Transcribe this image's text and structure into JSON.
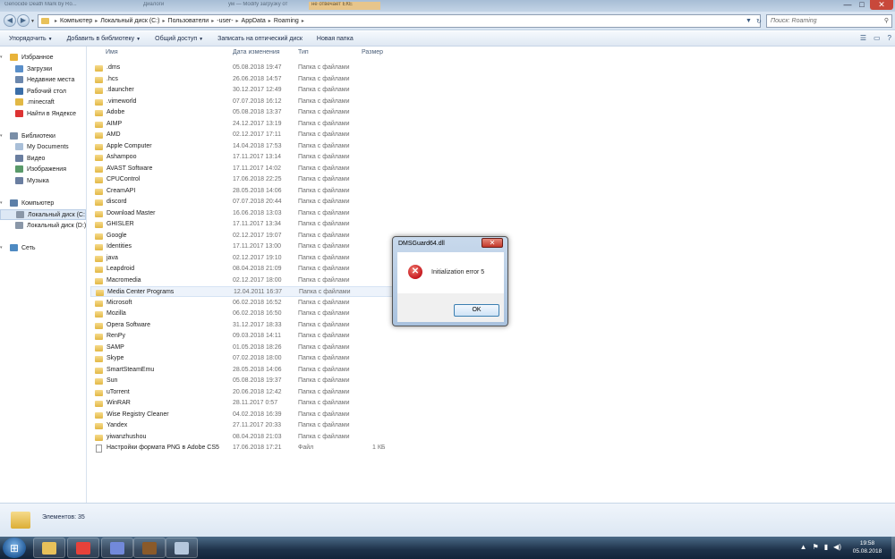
{
  "titlebar": {
    "ghost_tabs": [
      "Genocide Death Mark by Ro...",
      "Диалоги",
      "ум — Modify загрузку от",
      "не отвечает ЕКЕ"
    ],
    "minimize": "—",
    "maximize": "□",
    "close": "✕"
  },
  "address": {
    "back": "◀",
    "forward": "▶",
    "crumbs": [
      "Компьютер",
      "Локальный диск (C:)",
      "Пользователи",
      "-user-",
      "AppData",
      "Roaming"
    ],
    "refresh": "↻",
    "search_placeholder": "Поиск: Roaming",
    "search_icon": "search-icon"
  },
  "toolbar": {
    "items": [
      "Упорядочить",
      "Добавить в библиотеку",
      "Общий доступ",
      "Записать на оптический диск",
      "Новая папка"
    ]
  },
  "sidebar": {
    "items": [
      {
        "label": "Избранное",
        "icon": "star-icon",
        "color": "#e8b33a",
        "group": true
      },
      {
        "label": "Загрузки",
        "icon": "downloads-icon",
        "color": "#5a8fc9"
      },
      {
        "label": "Недавние места",
        "icon": "recent-places-icon",
        "color": "#6b87ad"
      },
      {
        "label": "Рабочий стол",
        "icon": "desktop-icon",
        "color": "#3b6ea8"
      },
      {
        "label": ".minecraft",
        "icon": "folder-icon",
        "color": "#e2b845"
      },
      {
        "label": "Найти в Яндексе",
        "icon": "yandex-icon",
        "color": "#d33"
      },
      {
        "label": "Библиотеки",
        "icon": "libraries-icon",
        "color": "#7a8fa8",
        "group": true
      },
      {
        "label": "My Documents",
        "icon": "documents-icon",
        "color": "#a9bfd8"
      },
      {
        "label": "Видео",
        "icon": "video-icon",
        "color": "#6a7ea0"
      },
      {
        "label": "Изображения",
        "icon": "images-icon",
        "color": "#5a9a6a"
      },
      {
        "label": "Музыка",
        "icon": "music-icon",
        "color": "#6a7ea0"
      },
      {
        "label": "Компьютер",
        "icon": "computer-icon",
        "color": "#5c7fa8",
        "group": true
      },
      {
        "label": "Локальный диск (C:)",
        "icon": "drive-icon",
        "color": "#8a97a8",
        "selected": true
      },
      {
        "label": "Локальный диск (D:)",
        "icon": "drive-icon",
        "color": "#8a97a8"
      },
      {
        "label": "Сеть",
        "icon": "network-icon",
        "color": "#4e8ac2",
        "group": true
      }
    ]
  },
  "columns": {
    "name": "Имя",
    "date": "Дата изменения",
    "type": "Тип",
    "size": "Размер"
  },
  "files": [
    {
      "name": ".dms",
      "date": "05.08.2018 19:47",
      "type": "Папка с файлами",
      "size": ""
    },
    {
      "name": ".hcs",
      "date": "26.06.2018 14:57",
      "type": "Папка с файлами",
      "size": ""
    },
    {
      "name": ".tlauncher",
      "date": "30.12.2017 12:49",
      "type": "Папка с файлами",
      "size": ""
    },
    {
      "name": ".vimeworld",
      "date": "07.07.2018 16:12",
      "type": "Папка с файлами",
      "size": ""
    },
    {
      "name": "Adobe",
      "date": "05.08.2018 13:37",
      "type": "Папка с файлами",
      "size": ""
    },
    {
      "name": "AIMP",
      "date": "24.12.2017 13:19",
      "type": "Папка с файлами",
      "size": ""
    },
    {
      "name": "AMD",
      "date": "02.12.2017 17:11",
      "type": "Папка с файлами",
      "size": ""
    },
    {
      "name": "Apple Computer",
      "date": "14.04.2018 17:53",
      "type": "Папка с файлами",
      "size": ""
    },
    {
      "name": "Ashampoo",
      "date": "17.11.2017 13:14",
      "type": "Папка с файлами",
      "size": ""
    },
    {
      "name": "AVAST Software",
      "date": "17.11.2017 14:02",
      "type": "Папка с файлами",
      "size": ""
    },
    {
      "name": "CPUControl",
      "date": "17.06.2018 22:25",
      "type": "Папка с файлами",
      "size": ""
    },
    {
      "name": "CreamAPI",
      "date": "28.05.2018 14:06",
      "type": "Папка с файлами",
      "size": ""
    },
    {
      "name": "discord",
      "date": "07.07.2018 20:44",
      "type": "Папка с файлами",
      "size": ""
    },
    {
      "name": "Download Master",
      "date": "16.06.2018 13:03",
      "type": "Папка с файлами",
      "size": ""
    },
    {
      "name": "GHISLER",
      "date": "17.11.2017 13:34",
      "type": "Папка с файлами",
      "size": ""
    },
    {
      "name": "Google",
      "date": "02.12.2017 19:07",
      "type": "Папка с файлами",
      "size": ""
    },
    {
      "name": "Identities",
      "date": "17.11.2017 13:00",
      "type": "Папка с файлами",
      "size": ""
    },
    {
      "name": "java",
      "date": "02.12.2017 19:10",
      "type": "Папка с файлами",
      "size": ""
    },
    {
      "name": "Leapdroid",
      "date": "08.04.2018 21:09",
      "type": "Папка с файлами",
      "size": ""
    },
    {
      "name": "Macromedia",
      "date": "02.12.2017 18:00",
      "type": "Папка с файлами",
      "size": ""
    },
    {
      "name": "Media Center Programs",
      "date": "12.04.2011 16:37",
      "type": "Папка с файлами",
      "size": "",
      "hover": true
    },
    {
      "name": "Microsoft",
      "date": "06.02.2018 16:52",
      "type": "Папка с файлами",
      "size": ""
    },
    {
      "name": "Mozilla",
      "date": "06.02.2018 16:50",
      "type": "Папка с файлами",
      "size": ""
    },
    {
      "name": "Opera Software",
      "date": "31.12.2017 18:33",
      "type": "Папка с файлами",
      "size": ""
    },
    {
      "name": "RenPy",
      "date": "09.03.2018 14:11",
      "type": "Папка с файлами",
      "size": ""
    },
    {
      "name": "SAMP",
      "date": "01.05.2018 18:26",
      "type": "Папка с файлами",
      "size": ""
    },
    {
      "name": "Skype",
      "date": "07.02.2018 18:00",
      "type": "Папка с файлами",
      "size": ""
    },
    {
      "name": "SmartSteamEmu",
      "date": "28.05.2018 14:06",
      "type": "Папка с файлами",
      "size": ""
    },
    {
      "name": "Sun",
      "date": "05.08.2018 19:37",
      "type": "Папка с файлами",
      "size": ""
    },
    {
      "name": "uTorrent",
      "date": "20.06.2018 12:42",
      "type": "Папка с файлами",
      "size": ""
    },
    {
      "name": "WinRAR",
      "date": "28.11.2017 0:57",
      "type": "Папка с файлами",
      "size": ""
    },
    {
      "name": "Wise Registry Cleaner",
      "date": "04.02.2018 16:39",
      "type": "Папка с файлами",
      "size": ""
    },
    {
      "name": "Yandex",
      "date": "27.11.2017 20:33",
      "type": "Папка с файлами",
      "size": ""
    },
    {
      "name": "yiwanzhushou",
      "date": "08.04.2018 21:03",
      "type": "Папка с файлами",
      "size": ""
    },
    {
      "name": "Настройки формата PNG в Adobe CS5",
      "date": "17.06.2018 17:21",
      "type": "Файл",
      "size": "1 КБ",
      "file": true
    }
  ],
  "status": {
    "count_text": "Элементов: 35"
  },
  "dialog": {
    "title": "DMSGuard64.dll",
    "message": "Initialization error 5",
    "ok_label": "OK",
    "close_glyph": "✕",
    "error_glyph": "✕"
  },
  "taskbar": {
    "start_glyph": "⊞",
    "apps": [
      {
        "name": "explorer-app",
        "color": "#e8c15a"
      },
      {
        "name": "yandex-browser-app",
        "color": "#e8413a"
      },
      {
        "name": "discord-app",
        "color": "#7289da"
      },
      {
        "name": "game-app",
        "color": "#8a5a2a"
      },
      {
        "name": "dmsguard-app",
        "color": "#b5c7dc"
      }
    ],
    "tray_icons": [
      "▲",
      "⚑",
      "▮",
      "◀)"
    ],
    "time": "19:58",
    "date": "05.08.2018"
  }
}
